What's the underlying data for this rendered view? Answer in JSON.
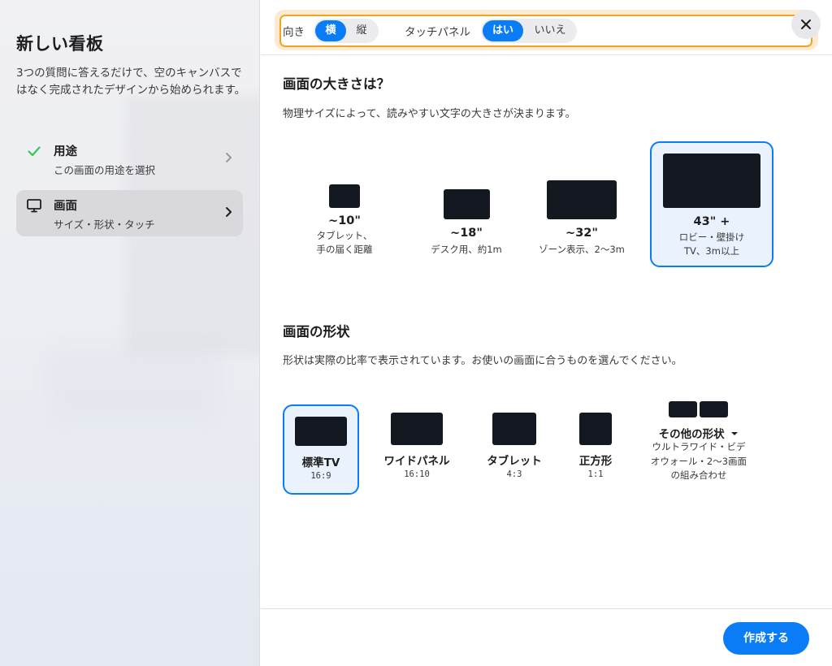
{
  "sidebar": {
    "title": "新しい看板",
    "description": "3つの質問に答えるだけで、空のキャンバスではなく完成されたデザインから始められます。",
    "steps": [
      {
        "label": "用途",
        "sub": "この画面の用途を選択",
        "status": "complete",
        "icon": "check-icon"
      },
      {
        "label": "画面",
        "sub": "サイズ・形状・タッチ",
        "status": "active",
        "icon": "monitor-icon"
      }
    ]
  },
  "filters": {
    "orientation": {
      "label": "向き",
      "options": [
        "横",
        "縦"
      ],
      "selected": "横"
    },
    "touch": {
      "label": "タッチパネル",
      "options": [
        "はい",
        "いいえ"
      ],
      "selected": "はい"
    }
  },
  "size_section": {
    "title": "画面の大きさは？",
    "description": "物理サイズによって、読みやすい文字の大きさが決まります。",
    "options": [
      {
        "name": "~10\"",
        "sub1": "タブレット、",
        "sub2": "手の届く距離"
      },
      {
        "name": "~18\"",
        "sub1": "デスク用、約1m",
        "sub2": ""
      },
      {
        "name": "~32\"",
        "sub1": "ゾーン表示、2〜3m",
        "sub2": ""
      },
      {
        "name": "43\" +",
        "sub1": "ロビー・壁掛け",
        "sub2": "TV、3m以上"
      }
    ],
    "selected_index": 3
  },
  "shape_section": {
    "title": "画面の形状",
    "description": "形状は実際の比率で表示されています。お使いの画面に合うものを選んでください。",
    "options": [
      {
        "name": "標準TV",
        "ratio": "16:9"
      },
      {
        "name": "ワイドパネル",
        "ratio": "16:10"
      },
      {
        "name": "タブレット",
        "ratio": "4:3"
      },
      {
        "name": "正方形",
        "ratio": "1:1"
      }
    ],
    "other": {
      "name": "その他の形状",
      "sub1": "ウルトラワイド・ビデ",
      "sub2": "オウォール・2〜3画面",
      "sub3": "の組み合わせ"
    },
    "selected_index": 0
  },
  "footer": {
    "create_label": "作成する"
  },
  "colors": {
    "accent": "#0a7cf5",
    "highlight_border": "#f2a324",
    "selected_bg": "#eaf2fe"
  }
}
